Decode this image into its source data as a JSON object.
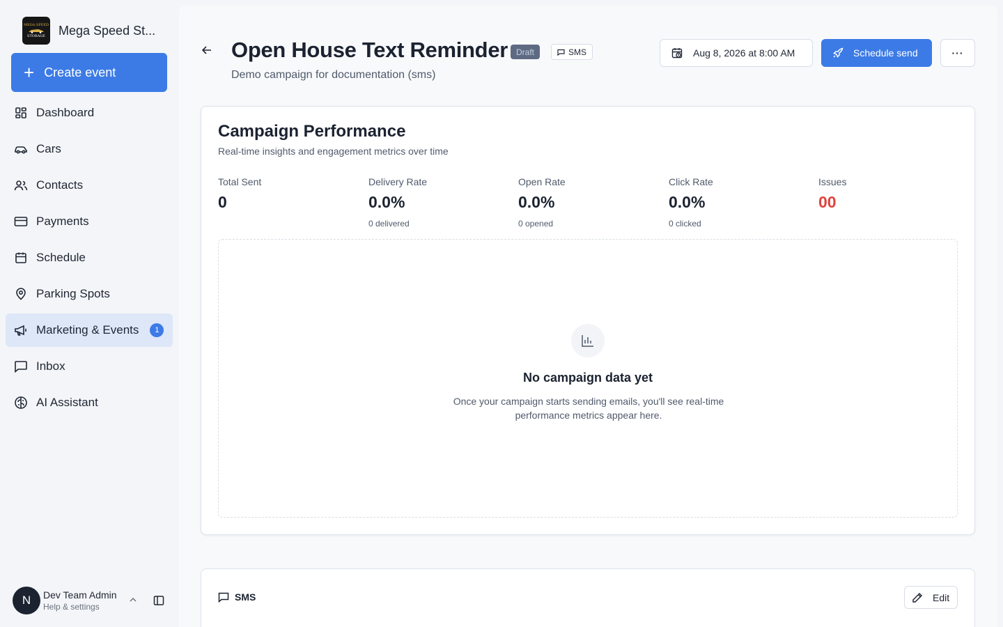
{
  "sidebar": {
    "brand_name": "Mega Speed St...",
    "logo_text_top": "MEGA SPEED",
    "logo_text_bottom": "STORAGE",
    "create_label": "Create event",
    "items": [
      {
        "label": "Dashboard",
        "icon": "dashboard-icon"
      },
      {
        "label": "Cars",
        "icon": "car-icon"
      },
      {
        "label": "Contacts",
        "icon": "users-icon"
      },
      {
        "label": "Payments",
        "icon": "credit-card-icon"
      },
      {
        "label": "Schedule",
        "icon": "calendar-icon"
      },
      {
        "label": "Parking Spots",
        "icon": "map-pin-icon"
      },
      {
        "label": "Marketing & Events",
        "icon": "megaphone-icon",
        "badge": "1",
        "active": true
      },
      {
        "label": "Inbox",
        "icon": "message-square-icon"
      },
      {
        "label": "AI Assistant",
        "icon": "brain-icon"
      }
    ],
    "user": {
      "initial": "N",
      "name": "Dev Team Admin",
      "sub": "Help & settings"
    }
  },
  "header": {
    "title": "Open House Text Reminder",
    "status_badge": "Draft",
    "channel_badge": "SMS",
    "subtitle": "Demo campaign for documentation (sms)",
    "date_label": "Aug 8, 2026 at 8:00 AM",
    "schedule_label": "Schedule send",
    "more_label": "···"
  },
  "performance": {
    "title": "Campaign Performance",
    "subtitle": "Real-time insights and engagement metrics over time",
    "metrics": [
      {
        "label": "Total Sent",
        "value": "0",
        "foot": ""
      },
      {
        "label": "Delivery Rate",
        "value": "0.0%",
        "foot": "0 delivered"
      },
      {
        "label": "Open Rate",
        "value": "0.0%",
        "foot": "0 opened"
      },
      {
        "label": "Click Rate",
        "value": "0.0%",
        "foot": "0 clicked"
      },
      {
        "label": "Issues",
        "value": "00",
        "foot": ""
      }
    ],
    "empty_title": "No campaign data yet",
    "empty_desc": "Once your campaign starts sending emails, you'll see real-time performance metrics appear here."
  },
  "sms_section": {
    "title": "SMS",
    "edit_label": "Edit"
  },
  "colors": {
    "accent": "#3c7be6",
    "issues": "#e0443e",
    "active_nav": "#dde7f8"
  }
}
